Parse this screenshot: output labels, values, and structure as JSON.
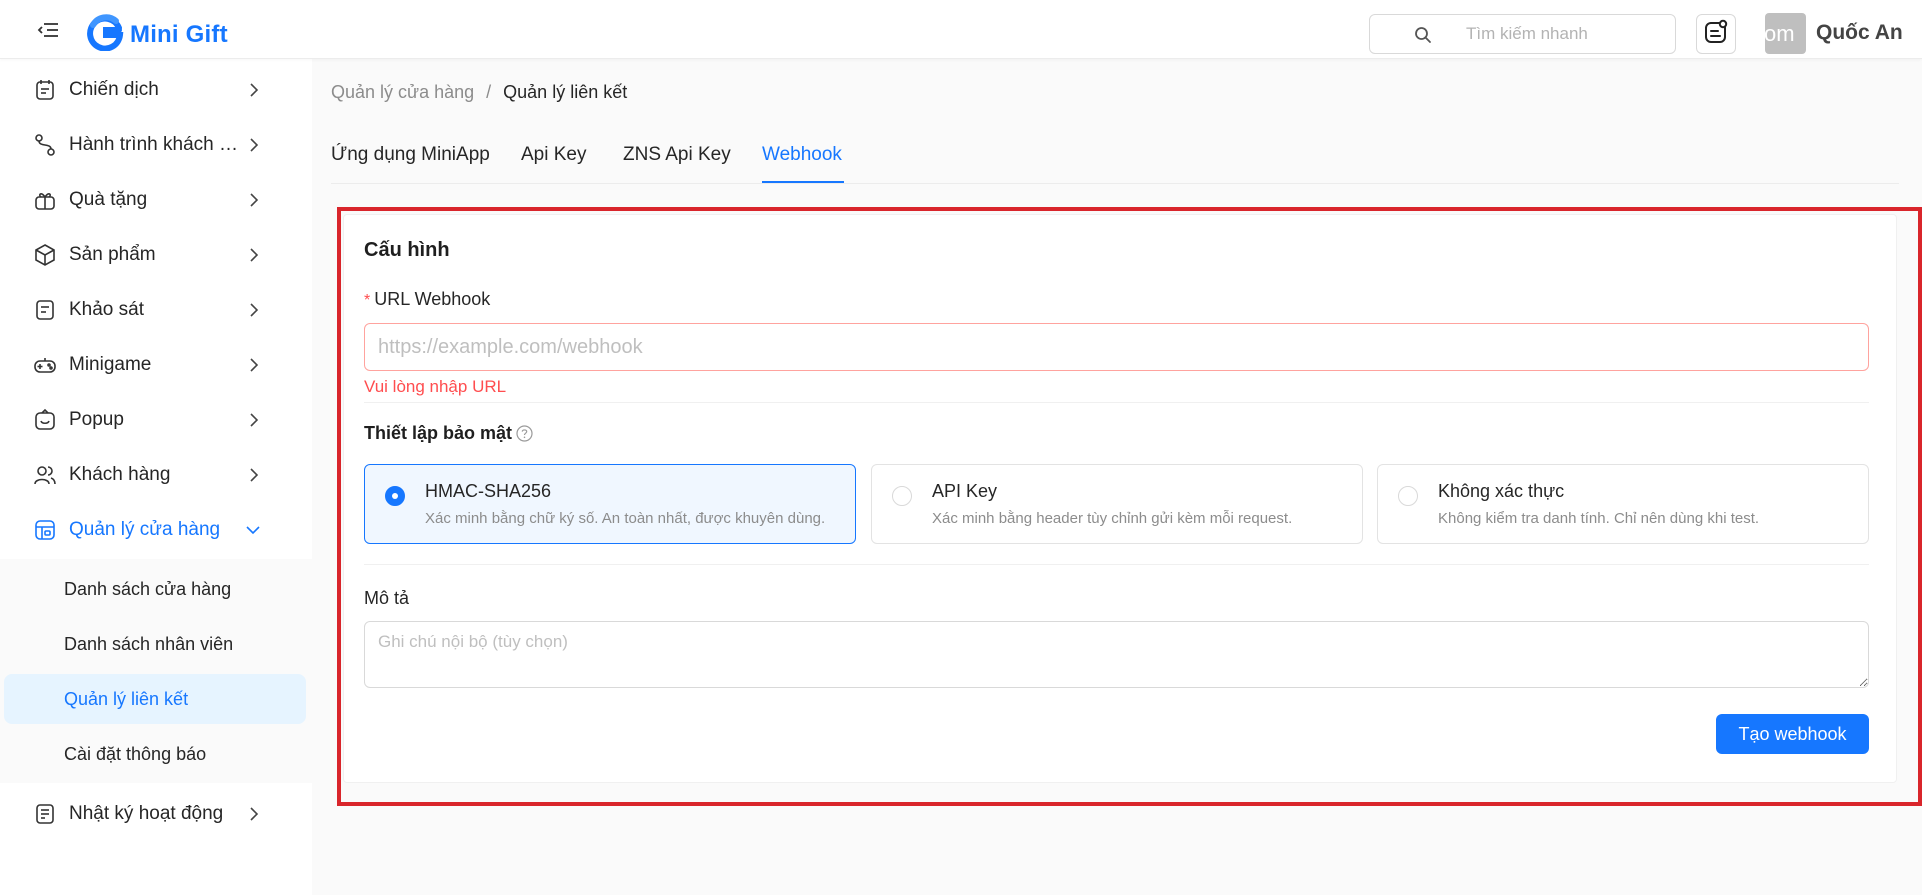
{
  "colors": {
    "accent": "#1677ff",
    "error": "#ff4d4f",
    "highlight_frame": "#d9252b",
    "selected_bg": "#e6f4ff"
  },
  "header": {
    "logo_text": "Mini Gift",
    "search_placeholder": "Tìm kiếm nhanh",
    "avatar_text": "com",
    "user_name": "Quốc An",
    "icons": [
      "menu-fold-icon",
      "logo-g-icon",
      "search-icon",
      "notification-icon"
    ]
  },
  "sidebar": {
    "items": [
      {
        "label": "Chiến dịch",
        "icon": "campaign-icon"
      },
      {
        "label": "Hành trình khách hàng",
        "icon": "journey-icon"
      },
      {
        "label": "Quà tặng",
        "icon": "gift-icon"
      },
      {
        "label": "Sản phẩm",
        "icon": "box-icon"
      },
      {
        "label": "Khảo sát",
        "icon": "survey-icon"
      },
      {
        "label": "Minigame",
        "icon": "gamepad-icon"
      },
      {
        "label": "Popup",
        "icon": "popup-icon"
      },
      {
        "label": "Khách hàng",
        "icon": "users-icon"
      },
      {
        "label": "Quản lý cửa hàng",
        "icon": "store-icon"
      },
      {
        "label": "Nhật ký hoạt động",
        "icon": "log-icon"
      }
    ],
    "submenu": [
      {
        "label": "Danh sách cửa hàng"
      },
      {
        "label": "Danh sách nhân viên"
      },
      {
        "label": "Quản lý liên kết"
      },
      {
        "label": "Cài đặt thông báo"
      }
    ]
  },
  "breadcrumb": {
    "parent": "Quản lý cửa hàng",
    "separator": "/",
    "current": "Quản lý liên kết"
  },
  "tabs": [
    {
      "label": "Ứng dụng MiniApp"
    },
    {
      "label": "Api Key"
    },
    {
      "label": "ZNS Api Key"
    },
    {
      "label": "Webhook"
    }
  ],
  "form": {
    "title": "Cấu hình",
    "url_label": "URL Webhook",
    "required_mark": "*",
    "url_placeholder": "https://example.com/webhook",
    "url_value": "",
    "url_error": "Vui lòng nhập URL",
    "security_title": "Thiết lập bảo mật",
    "security_options": [
      {
        "title": "HMAC-SHA256",
        "desc": "Xác minh bằng chữ ký số. An toàn nhất, được khuyên dùng."
      },
      {
        "title": "API Key",
        "desc": "Xác minh bằng header tùy chỉnh gửi kèm mỗi request."
      },
      {
        "title": "Không xác thực",
        "desc": "Không kiểm tra danh tính. Chỉ nên dùng khi test."
      }
    ],
    "selected_security": "HMAC-SHA256",
    "desc_label": "Mô tả",
    "desc_placeholder": "Ghi chú nội bộ (tùy chọn)",
    "submit_label": "Tạo webhook"
  }
}
